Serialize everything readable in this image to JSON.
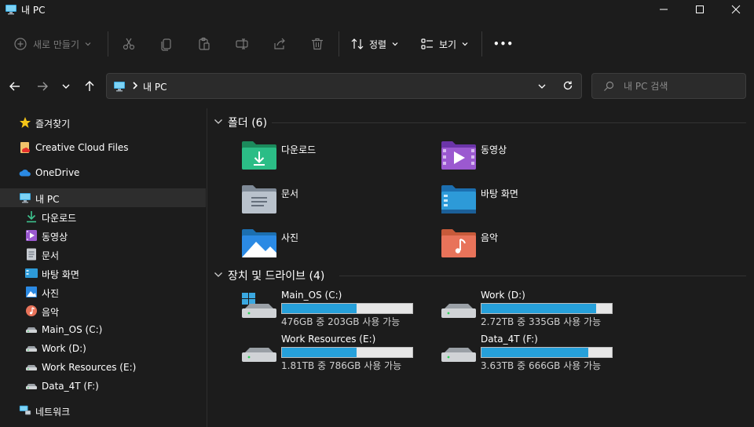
{
  "window": {
    "title": "내 PC"
  },
  "toolbar": {
    "new_label": "새로 만들기",
    "sort_label": "정렬",
    "view_label": "보기",
    "more_label": "•••"
  },
  "address": {
    "path": "내 PC"
  },
  "search": {
    "placeholder": "내 PC 검색"
  },
  "sidebar": {
    "items": [
      {
        "label": "즐겨찾기",
        "icon": "star-icon"
      },
      {
        "label": "Creative Cloud Files",
        "icon": "creative-cloud-icon"
      },
      {
        "label": "OneDrive",
        "icon": "onedrive-icon"
      },
      {
        "label": "내 PC",
        "icon": "monitor-icon"
      },
      {
        "label": "다운로드",
        "icon": "download-icon"
      },
      {
        "label": "동영상",
        "icon": "video-icon"
      },
      {
        "label": "문서",
        "icon": "document-icon"
      },
      {
        "label": "바탕 화면",
        "icon": "desktop-icon"
      },
      {
        "label": "사진",
        "icon": "pictures-icon"
      },
      {
        "label": "음악",
        "icon": "music-icon"
      },
      {
        "label": "Main_OS (C:)",
        "icon": "drive-icon"
      },
      {
        "label": "Work (D:)",
        "icon": "drive-icon"
      },
      {
        "label": "Work Resources (E:)",
        "icon": "drive-icon"
      },
      {
        "label": "Data_4T (F:)",
        "icon": "drive-icon"
      },
      {
        "label": "네트워크",
        "icon": "network-icon"
      }
    ]
  },
  "folders": {
    "header": "폴더 (6)",
    "items": [
      {
        "name": "다운로드",
        "icon": "downloads-folder-icon"
      },
      {
        "name": "동영상",
        "icon": "videos-folder-icon"
      },
      {
        "name": "문서",
        "icon": "documents-folder-icon"
      },
      {
        "name": "바탕 화면",
        "icon": "desktop-folder-icon"
      },
      {
        "name": "사진",
        "icon": "pictures-folder-icon"
      },
      {
        "name": "음악",
        "icon": "music-folder-icon"
      }
    ]
  },
  "drives": {
    "header": "장치 및 드라이브 (4)",
    "items": [
      {
        "name": "Main_OS (C:)",
        "free_text": "476GB 중 203GB 사용 가능",
        "used_fraction": 0.57
      },
      {
        "name": "Work (D:)",
        "free_text": "2.72TB 중 335GB 사용 가능",
        "used_fraction": 0.88
      },
      {
        "name": "Work Resources (E:)",
        "free_text": "1.81TB 중 786GB 사용 가능",
        "used_fraction": 0.57
      },
      {
        "name": "Data_4T (F:)",
        "free_text": "3.63TB 중 666GB 사용 가능",
        "used_fraction": 0.82
      }
    ]
  },
  "colors": {
    "accent": "#26a0da",
    "background": "#1c1c1c",
    "selected": "#2d2d2d"
  }
}
